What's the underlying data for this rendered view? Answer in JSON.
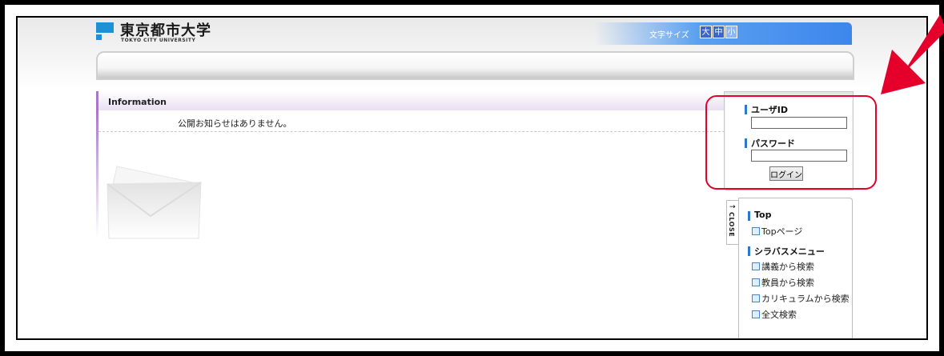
{
  "header": {
    "logo_jp": "東京都市大学",
    "logo_en": "TOKYO CITY UNIVERSITY",
    "font_size_label": "文字サイズ",
    "font_sizes": [
      "大",
      "中",
      "小"
    ]
  },
  "info": {
    "title": "Information",
    "message": "公開お知らせはありません。"
  },
  "login": {
    "user_label": "ユーザID",
    "user_value": "",
    "password_label": "パスワード",
    "password_value": "",
    "button": "ログイン"
  },
  "menu": {
    "close_tab": "CLOSE",
    "close_arrow": "→",
    "sections": [
      {
        "title": "Top",
        "items": [
          "Topページ"
        ]
      },
      {
        "title": "シラバスメニュー",
        "items": [
          "講義から検索",
          "教員から検索",
          "カリキュラムから検索",
          "全文検索"
        ]
      }
    ]
  },
  "colors": {
    "accent_blue": "#3d86ec",
    "highlight_red": "#e4002b",
    "info_purple": "#a679c8"
  }
}
